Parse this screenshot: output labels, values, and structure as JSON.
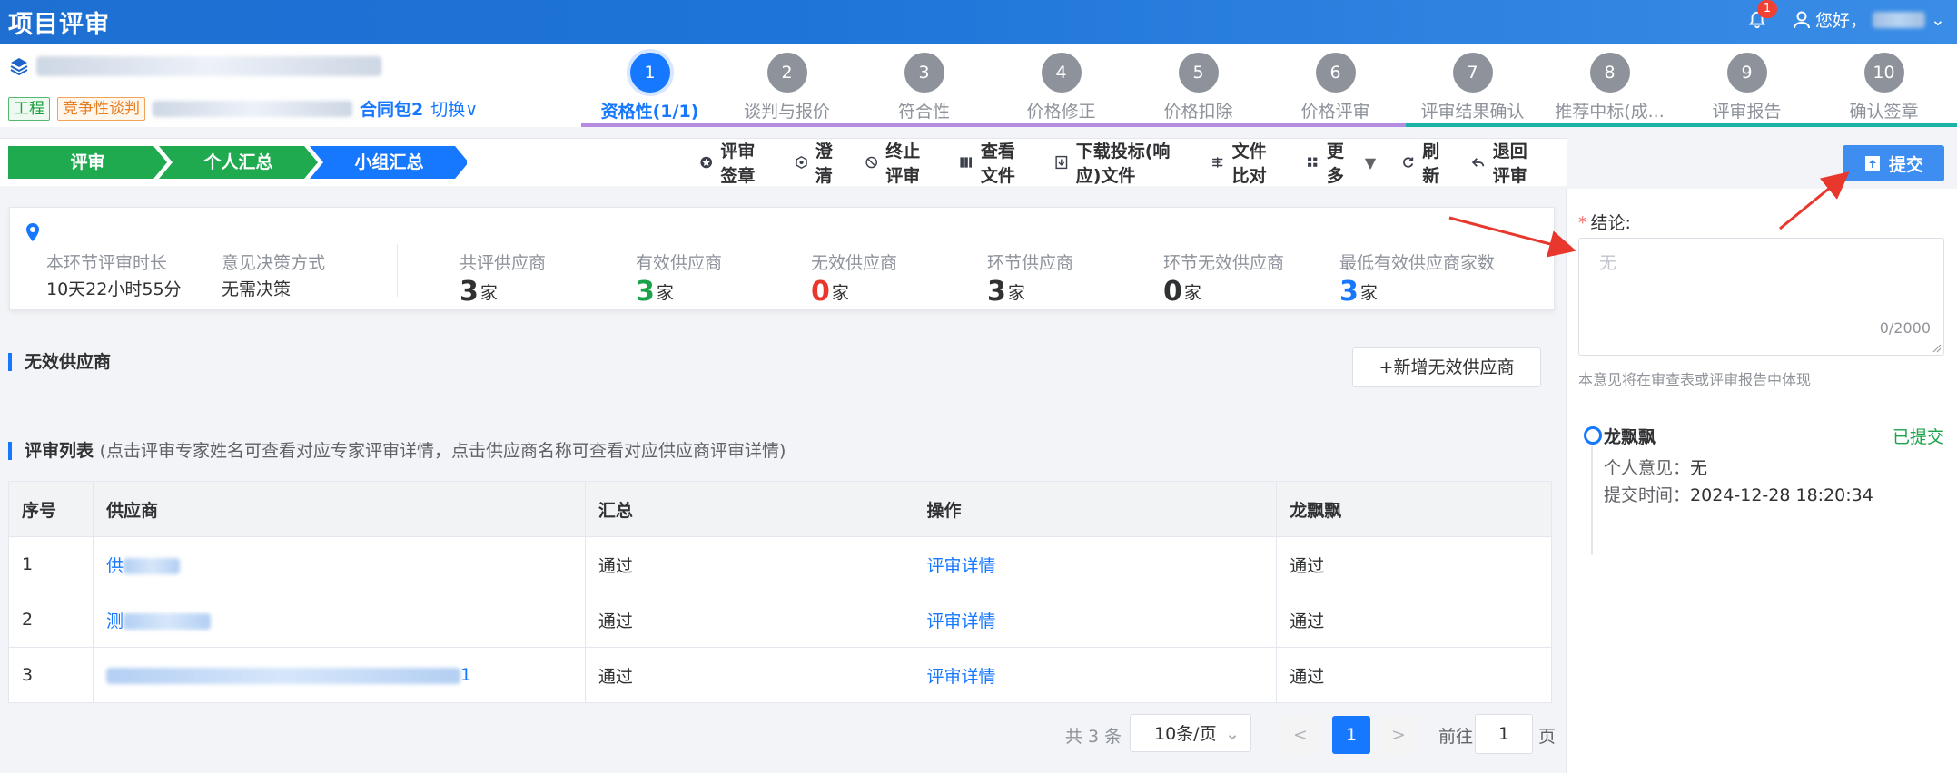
{
  "app": {
    "title": "项目评审"
  },
  "topbar": {
    "notification_count": "1",
    "greeting": "您好，"
  },
  "project": {
    "tags": [
      "工程",
      "竞争性谈判"
    ],
    "contract": "合同包2",
    "switch": "切换∨"
  },
  "steps": [
    {
      "num": "1",
      "label": "资格性(1/1)"
    },
    {
      "num": "2",
      "label": "谈判与报价"
    },
    {
      "num": "3",
      "label": "符合性"
    },
    {
      "num": "4",
      "label": "价格修正"
    },
    {
      "num": "5",
      "label": "价格扣除"
    },
    {
      "num": "6",
      "label": "价格评审"
    },
    {
      "num": "7",
      "label": "评审结果确认"
    },
    {
      "num": "8",
      "label": "推荐中标(成..."
    },
    {
      "num": "9",
      "label": "评审报告"
    },
    {
      "num": "10",
      "label": "确认签章"
    }
  ],
  "crumbs": [
    "评审",
    "个人汇总",
    "小组汇总"
  ],
  "toolbar": {
    "sign": "评审签章",
    "clarify": "澄清",
    "terminate": "终止评审",
    "view_files": "查看文件",
    "download": "下载投标(响应)文件",
    "compare": "文件比对",
    "more": "更多",
    "refresh": "刷新",
    "return": "退回评审",
    "submit": "提交"
  },
  "stats": {
    "duration_label": "本环节评审时长",
    "duration_value": "10天22小时55分",
    "decision_label": "意见决策方式",
    "decision_value": "无需决策",
    "unit": "家",
    "items": [
      {
        "label": "共评供应商",
        "value": "3",
        "color": "#303133"
      },
      {
        "label": "有效供应商",
        "value": "3",
        "color": "#1aa34a"
      },
      {
        "label": "无效供应商",
        "value": "0",
        "color": "#e8372c"
      },
      {
        "label": "环节供应商",
        "value": "3",
        "color": "#303133"
      },
      {
        "label": "环节无效供应商",
        "value": "0",
        "color": "#303133"
      },
      {
        "label": "最低有效供应商家数",
        "value": "3",
        "color": "#1677ff"
      }
    ]
  },
  "invalid": {
    "title": "无效供应商",
    "add_button": "+新增无效供应商"
  },
  "review": {
    "title": "评审列表",
    "hint": "(点击评审专家姓名可查看对应专家评审详情，点击供应商名称可查看对应供应商评审详情)",
    "columns": [
      "序号",
      "供应商",
      "汇总",
      "操作",
      "龙飘飘"
    ],
    "rows": [
      {
        "no": "1",
        "supplier": "供",
        "summary": "通过",
        "action": "评审详情",
        "expert": "通过"
      },
      {
        "no": "2",
        "supplier": "测",
        "summary": "通过",
        "action": "评审详情",
        "expert": "通过"
      },
      {
        "no": "3",
        "supplier": "1",
        "summary": "通过",
        "action": "评审详情",
        "expert": "通过"
      }
    ]
  },
  "pager": {
    "total": "共 3 条",
    "page_size": "10条/页",
    "prev": "<",
    "current": "1",
    "next": ">",
    "goto": "前往",
    "goto_value": "1",
    "unit": "页"
  },
  "conclusion": {
    "label": "结论:",
    "placeholder": "无",
    "counter": "0/2000",
    "note": "本意见将在审查表或评审报告中体现"
  },
  "timeline": {
    "name": "龙飘飘",
    "status": "已提交",
    "opinion_label": "个人意见：",
    "opinion_value": "无",
    "time_label": "提交时间：",
    "time_value": "2024-12-28 18:20:34"
  }
}
